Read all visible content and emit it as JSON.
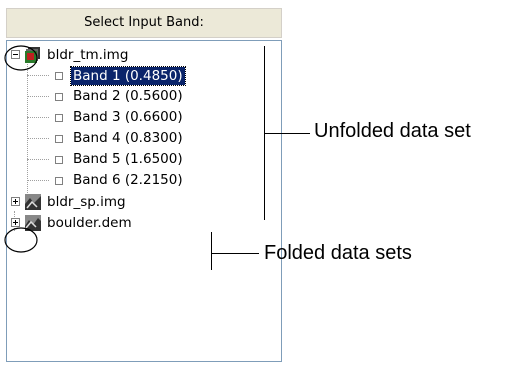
{
  "header": {
    "title": "Select Input Band:"
  },
  "tree": {
    "datasets": [
      {
        "name": "bldr_tm.img",
        "expander": "−",
        "icon": "raster-color-icon"
      },
      {
        "name": "bldr_sp.img",
        "expander": "+",
        "icon": "raster-gray-icon"
      },
      {
        "name": "boulder.dem",
        "expander": "+",
        "icon": "raster-gray-icon"
      }
    ],
    "bands": [
      "Band 1 (0.4850)",
      "Band 2 (0.5600)",
      "Band 3 (0.6600)",
      "Band 4 (0.8300)",
      "Band 5 (1.6500)",
      "Band 6 (2.2150)"
    ]
  },
  "annotations": {
    "unfolded": "Unfolded data set",
    "folded": "Folded data sets"
  },
  "colors": {
    "selection": "#0a246a",
    "header_bg": "#ece9d8"
  }
}
